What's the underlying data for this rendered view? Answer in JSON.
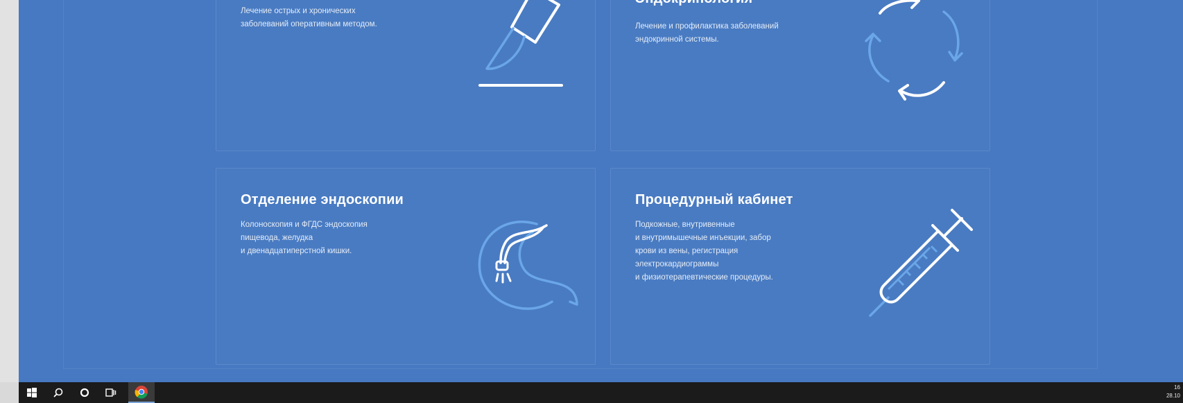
{
  "cards": [
    {
      "title": "",
      "description": "Лечение острых и хронических\nзаболеваний оперативным методом.",
      "icon": "scalpel-icon"
    },
    {
      "title": "Эндокринология",
      "description": "Лечение и профилактика заболеваний\nэндокринной системы.",
      "icon": "cycle-arrows-icon"
    },
    {
      "title": "Отделение эндоскопии",
      "description": "Колоноскопия и ФГДС эндоскопия\nпищевода, желудка\nи двенадцатиперстной кишки.",
      "icon": "stomach-endoscope-icon"
    },
    {
      "title": "Процедурный кабинет",
      "description": "Подкожные, внутривенные\nи внутримышечные инъекции, забор\nкрови из вены, регистрация\nэлектрокардиограммы\nи физиотерапевтические процедуры.",
      "icon": "syringe-icon"
    }
  ],
  "taskbar": {
    "icons": [
      "windows-start-icon",
      "search-icon",
      "cortana-icon",
      "task-view-icon",
      "chrome-icon"
    ],
    "clock": {
      "time": "16",
      "date": "28.10"
    }
  },
  "colors": {
    "page_bg": "#4779c2",
    "taskbar_bg": "#1b1b1b",
    "accent_light": "#6aa6e8"
  }
}
